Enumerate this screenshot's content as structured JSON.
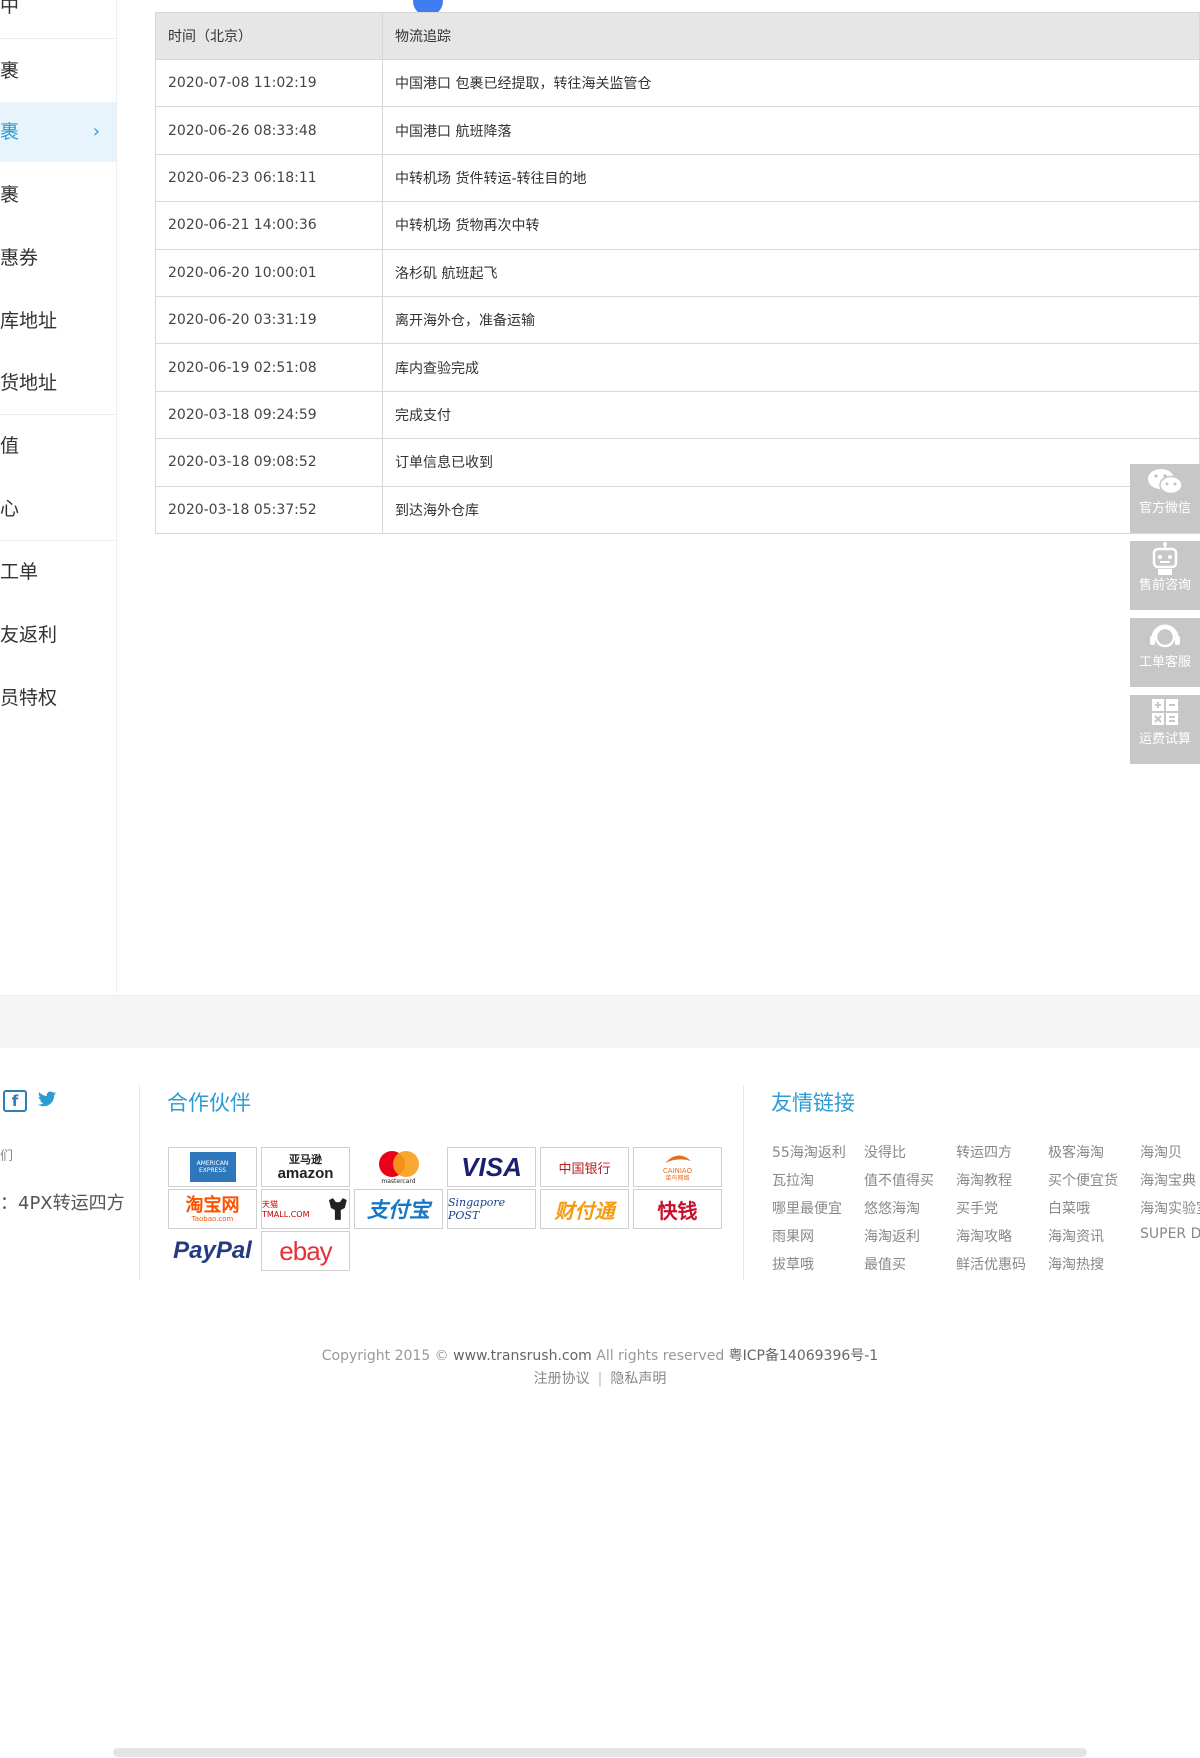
{
  "sidebar": {
    "items": [
      {
        "label": "中"
      },
      {
        "label": "裹"
      },
      {
        "label": "裹"
      },
      {
        "label": "裹"
      },
      {
        "label": "惠券"
      },
      {
        "label": "库地址"
      },
      {
        "label": "货地址"
      },
      {
        "label": "值"
      },
      {
        "label": "心"
      },
      {
        "label": "工单"
      },
      {
        "label": "友返利"
      },
      {
        "label": "员特权"
      }
    ],
    "active_chevron": "›"
  },
  "tracking": {
    "headers": {
      "time": "时间（北京）",
      "status": "物流追踪"
    },
    "rows": [
      {
        "time": "2020-07-08 11:02:19",
        "status": "中国港口 包裹已经提取，转往海关监管仓"
      },
      {
        "time": "2020-06-26 08:33:48",
        "status": "中国港口 航班降落"
      },
      {
        "time": "2020-06-23 06:18:11",
        "status": "中转机场 货件转运-转往目的地"
      },
      {
        "time": "2020-06-21 14:00:36",
        "status": "中转机场 货物再次中转"
      },
      {
        "time": "2020-06-20 10:00:01",
        "status": "洛杉矶 航班起飞"
      },
      {
        "time": "2020-06-20 03:31:19",
        "status": "离开海外仓，准备运输"
      },
      {
        "time": "2020-06-19 02:51:08",
        "status": "库内查验完成"
      },
      {
        "time": "2020-03-18 09:24:59",
        "status": "完成支付"
      },
      {
        "time": "2020-03-18 09:08:52",
        "status": "订单信息已收到"
      },
      {
        "time": "2020-03-18 05:37:52",
        "status": "到达海外仓库"
      }
    ]
  },
  "float_tools": [
    {
      "label": "官方微信",
      "icon": "wechat-icon"
    },
    {
      "label": "售前咨询",
      "icon": "robot-icon"
    },
    {
      "label": "工单客服",
      "icon": "headset-icon"
    },
    {
      "label": "运费试算",
      "icon": "calculator-icon"
    }
  ],
  "footer": {
    "social": {
      "facebook": "f",
      "twitter": "🐦"
    },
    "left_text1": "们",
    "left_text2": "：4PX转运四方",
    "partners_title": "合作伙伴",
    "partners": {
      "amex": "AMERICAN EXPRESS",
      "amazon_cn": "亚马逊",
      "amazon": "amazon",
      "mastercard": "mastercard",
      "visa": "VISA",
      "boc": "中国银行",
      "cainiao": "CAINIAO",
      "cainiao_cn": "菜鸟网络",
      "taobao": "淘宝网",
      "taobao_en": "Taobao.com",
      "tmall": "天猫 TMALL.COM",
      "alipay": "支付宝",
      "singpost": "Singapore POST",
      "caifutong": "财付通",
      "kuaiqian": "快钱",
      "paypal": "PayPal",
      "ebay": "ebay"
    },
    "friends_title": "友情链接",
    "friend_links": [
      "55海淘返利",
      "没得比",
      "转运四方",
      "极客海淘",
      "海淘贝",
      "瓦拉淘",
      "值不值得买",
      "海淘教程",
      "买个便宜货",
      "海淘宝典",
      "哪里最便宜",
      "悠悠海淘",
      "买手党",
      "白菜哦",
      "海淘实验室",
      "雨果网",
      "海淘返利",
      "海淘攻略",
      "海淘资讯",
      "SUPER D",
      "拔草哦",
      "最值买",
      "鲜活优惠码",
      "海淘热搜"
    ],
    "copyright_pre": "Copyright 2015 © ",
    "copyright_site": "www.transrush.com",
    "copyright_mid": " All rights reserved ",
    "copyright_icp": "粤ICP备14069396号-1",
    "legal_terms": "注册协议",
    "legal_sep": "|",
    "legal_privacy": "隐私声明"
  },
  "colors": {
    "accent": "#2d9cd6",
    "active_bg": "#e8f4fb",
    "tool_bg": "#c7c7c7",
    "dot": "#3f7cf0"
  }
}
